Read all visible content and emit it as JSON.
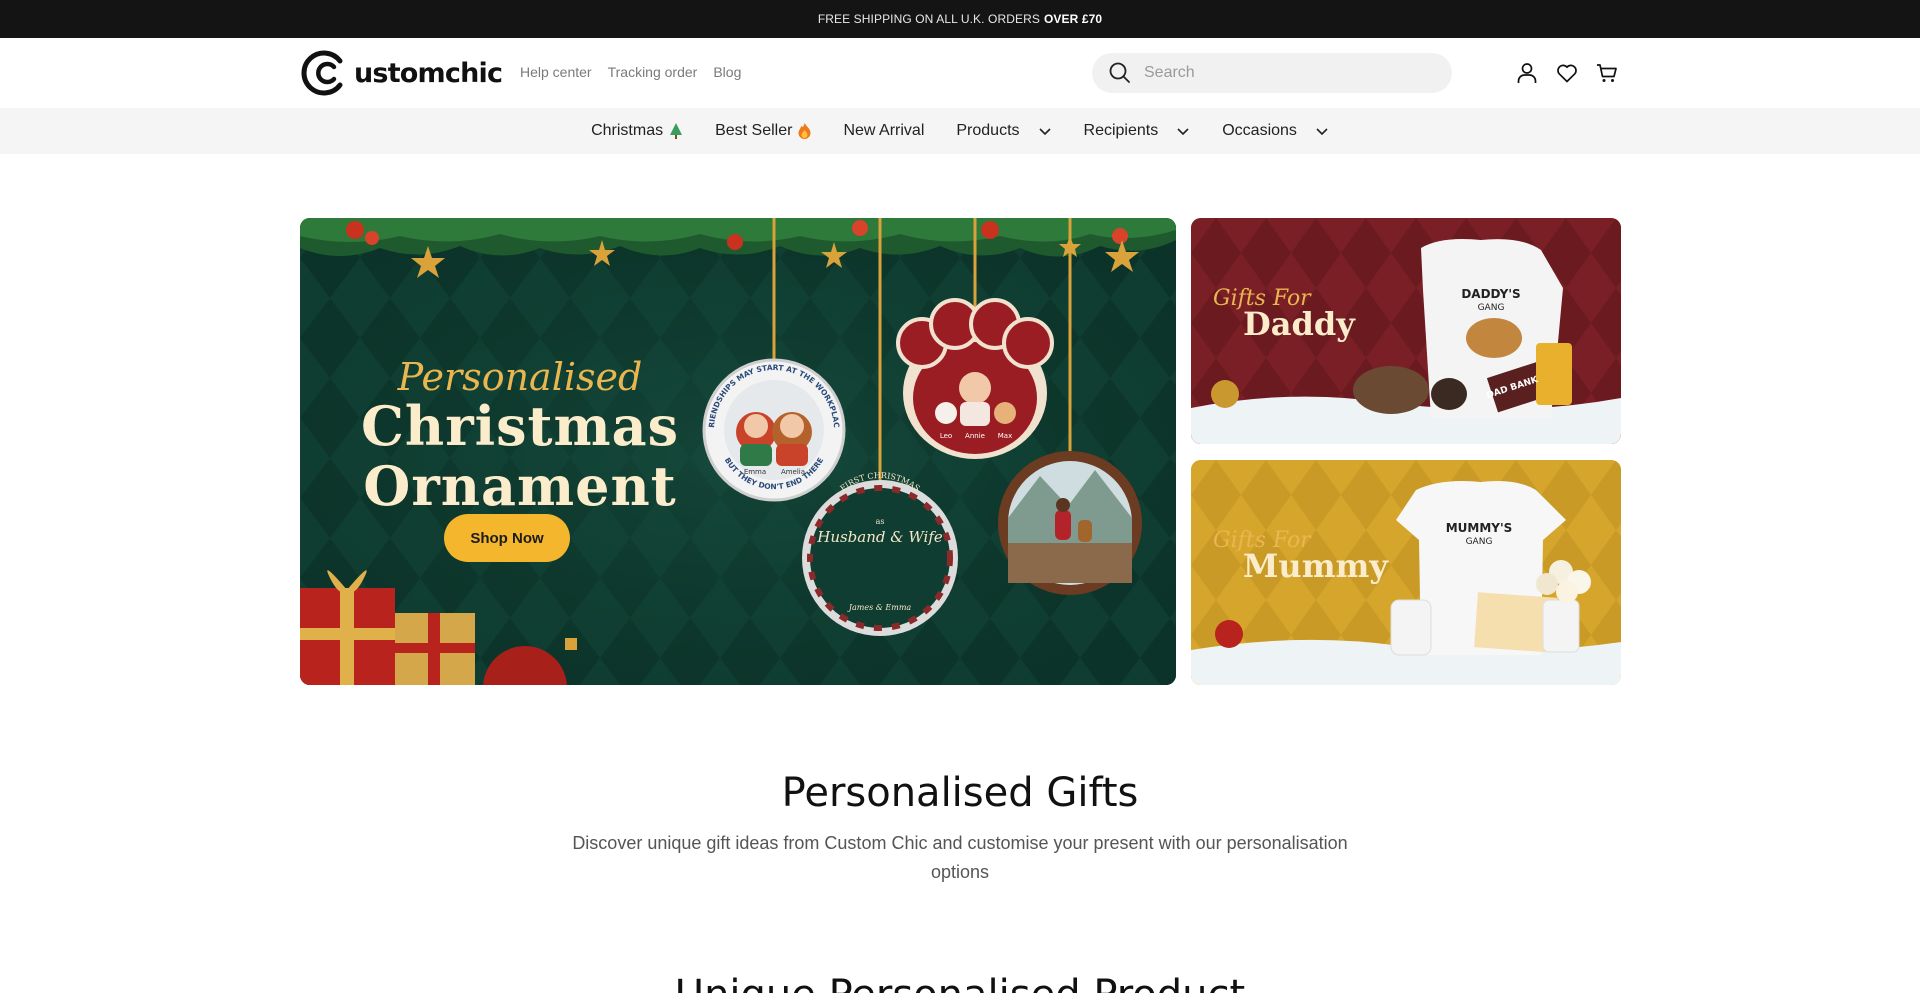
{
  "announcement": {
    "text": "FREE SHIPPING ON ALL U.K. ORDERS",
    "highlight": "OVER £70"
  },
  "header": {
    "logo_text": "ustomchic",
    "links": [
      "Help center",
      "Tracking order",
      "Blog"
    ],
    "search_placeholder": "Search",
    "icons": [
      "user-icon",
      "heart-icon",
      "cart-icon"
    ]
  },
  "nav": {
    "items": [
      {
        "label": "Christmas",
        "emoji": "🌲",
        "dropdown": false
      },
      {
        "label": "Best Seller",
        "emoji": "🔥",
        "dropdown": false
      },
      {
        "label": "New Arrival",
        "emoji": "",
        "dropdown": false
      },
      {
        "label": "Products",
        "emoji": "",
        "dropdown": true
      },
      {
        "label": "Recipients",
        "emoji": "",
        "dropdown": true
      },
      {
        "label": "Occasions",
        "emoji": "",
        "dropdown": true
      }
    ]
  },
  "hero": {
    "script": "Personalised",
    "line1": "Christmas",
    "line2": "Ornament",
    "button": "Shop Now",
    "ornament_texts": {
      "o1_top": "FRIENDSHIPS MAY START AT THE WORKPLACE",
      "o1_bottom": "BUT THEY DON'T END THERE",
      "o1_names": [
        "Emma",
        "Amelia"
      ],
      "o2_names": [
        "Leo",
        "Annie",
        "Max"
      ],
      "o3_top": "FIRST CHRISTMAS",
      "o3_mid": "as",
      "o3_main": "Husband & Wife",
      "o3_names": "James & Emma"
    }
  },
  "promo_daddy": {
    "script": "Gifts For",
    "title": "Daddy",
    "shirt_text": "DADDY'S",
    "shirt_sub": "GANG",
    "card_text": "DAD BANK"
  },
  "promo_mummy": {
    "script": "Gifts For",
    "title": "Mummy",
    "shirt_text": "MUMMY'S",
    "shirt_sub": "GANG"
  },
  "section": {
    "title": "Personalised Gifts",
    "subtitle": "Discover unique gift ideas from Custom Chic and customise your present with our personalisation options",
    "next_title": "Unique Personalised Product"
  },
  "colors": {
    "announcement_bg": "#141414",
    "nav_bg": "#f5f5f5",
    "button": "#f4b62c",
    "hero_green": "#0f3d31",
    "daddy_red": "#7a1f25",
    "mummy_gold": "#d6a52c"
  }
}
